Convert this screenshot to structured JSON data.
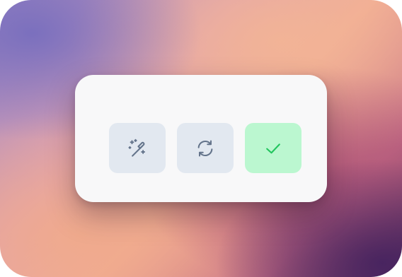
{
  "card": {
    "buttons": [
      {
        "id": "magic",
        "icon": "magic-wand-icon",
        "color": "#64748b",
        "background": "#e2e8f0"
      },
      {
        "id": "refresh",
        "icon": "refresh-icon",
        "color": "#64748b",
        "background": "#e2e8f0"
      },
      {
        "id": "confirm",
        "icon": "check-icon",
        "color": "#22c55e",
        "background": "#bbf7d0"
      }
    ]
  }
}
